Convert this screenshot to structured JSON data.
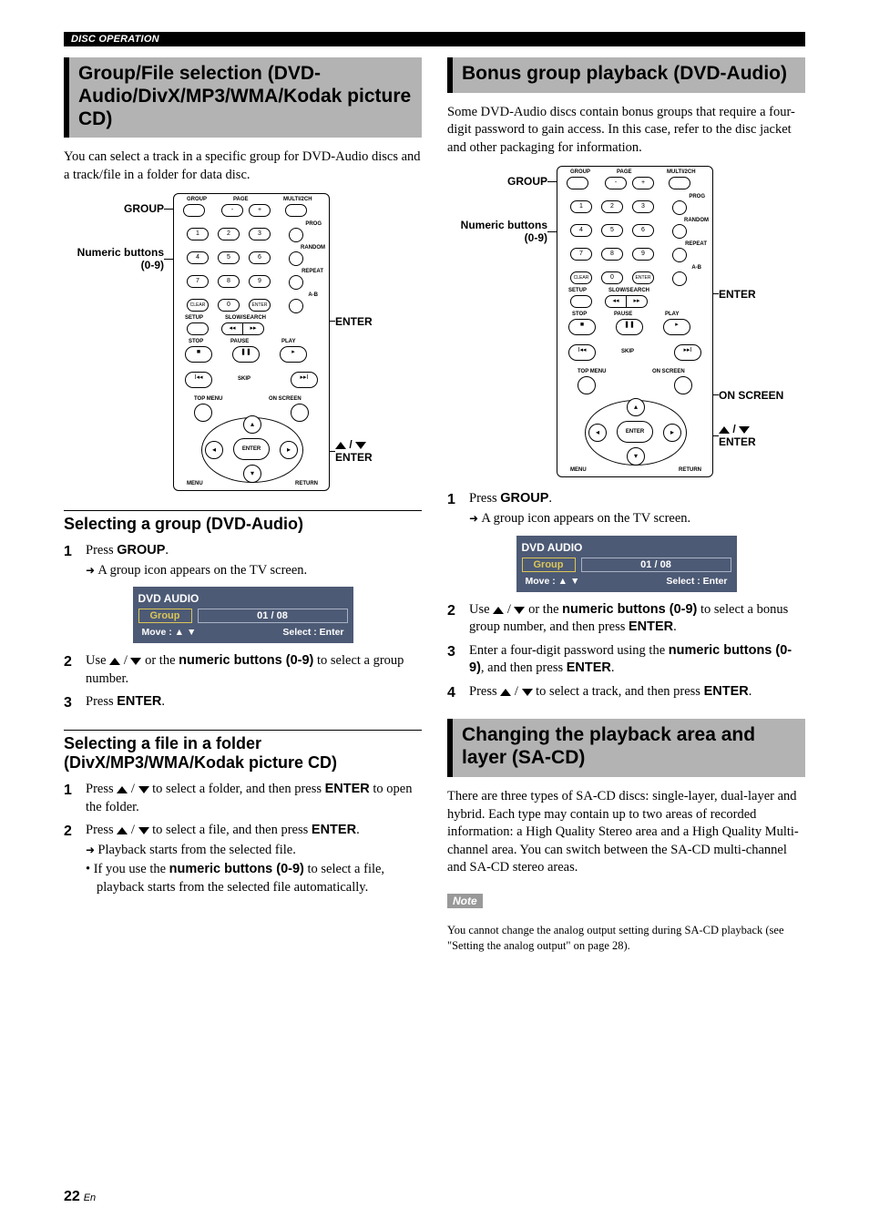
{
  "header": "DISC OPERATION",
  "left": {
    "section_title": "Group/File selection (DVD-Audio/DivX/MP3/WMA/Kodak picture CD)",
    "intro": "You can select a track in a specific group for DVD-Audio discs and a track/file in a folder for data disc.",
    "remote": {
      "group_label": "GROUP",
      "numeric_label": "Numeric buttons (0-9)",
      "enter_label": "ENTER",
      "arrows_enter": "▲ / ▼\nENTER",
      "top_row": {
        "group": "GROUP",
        "page": "PAGE",
        "multi": "MULTI/2CH"
      },
      "side": {
        "prog": "PROG",
        "random": "RANDOM",
        "repeat": "REPEAT",
        "ab": "A-B"
      },
      "row_clear": "CLEAR",
      "row_enter": "ENTER",
      "row_setup": "SETUP",
      "row_slow": "SLOW/SEARCH",
      "row_stop": "STOP",
      "row_pause": "PAUSE",
      "row_play": "PLAY",
      "row_skip": "SKIP",
      "row_topmenu": "TOP MENU",
      "row_onscreen": "ON SCREEN",
      "row_menu": "MENU",
      "row_return": "RETURN",
      "center": "ENTER"
    },
    "sub1": {
      "title": "Selecting a group (DVD-Audio)",
      "steps": [
        {
          "n": "1",
          "pre": "Press ",
          "bold": "GROUP",
          "post": ".",
          "result": "A group icon appears on the TV screen."
        },
        {
          "n": "2",
          "pre": "Use ",
          "mid": " / ",
          "post_pre": " or the ",
          "bold": "numeric buttons (0-9)",
          "post": " to select a group number."
        },
        {
          "n": "3",
          "pre": "Press ",
          "bold": "ENTER",
          "post": "."
        }
      ],
      "osd": {
        "title": "DVD AUDIO",
        "label": "Group",
        "value": "01 / 08",
        "hint_move": "Move :  ▲ ▼",
        "hint_select": "Select :  Enter"
      }
    },
    "sub2": {
      "title": "Selecting a file in a folder (DivX/MP3/WMA/Kodak picture CD)",
      "steps": [
        {
          "n": "1",
          "pre": "Press ",
          "mid": " / ",
          "post_pre": " to select a folder, and then press ",
          "bold": "ENTER",
          "post": " to open the folder."
        },
        {
          "n": "2",
          "pre": "Press ",
          "mid": " / ",
          "post_pre": " to select a file, and then press ",
          "bold": "ENTER",
          "post": ".",
          "result": "Playback starts from the selected file.",
          "bullet_pre": "If you use the ",
          "bullet_bold": "numeric buttons (0-9)",
          "bullet_post": " to select a file, playback starts from the selected file automatically."
        }
      ]
    }
  },
  "right": {
    "section1": {
      "title": "Bonus group playback (DVD-Audio)",
      "intro": "Some DVD-Audio discs contain bonus groups that require a four-digit password to gain access. In this case, refer to the disc jacket and other packaging for information.",
      "remote": {
        "group_label": "GROUP",
        "numeric_label": "Numeric buttons (0-9)",
        "enter_label": "ENTER",
        "onscreen_label": "ON SCREEN",
        "arrows_enter": "▲ / ▼\nENTER"
      },
      "steps": [
        {
          "n": "1",
          "pre": "Press ",
          "bold": "GROUP",
          "post": ".",
          "result": "A group icon appears on the TV screen."
        },
        {
          "n": "2",
          "pre": "Use ",
          "mid": " / ",
          "post_pre": " or the ",
          "bold": "numeric buttons (0-9)",
          "post": " to select a bonus group number, and then press ",
          "bold2": "ENTER",
          "post2": "."
        },
        {
          "n": "3",
          "pre": "Enter a four-digit password using the ",
          "bold": "numeric buttons (0-9)",
          "post": ", and then press ",
          "bold2": "ENTER",
          "post2": "."
        },
        {
          "n": "4",
          "pre": "Press ",
          "mid": " / ",
          "post_pre": " to select a track, and then press ",
          "bold": "ENTER",
          "post": "."
        }
      ],
      "osd": {
        "title": "DVD AUDIO",
        "label": "Group",
        "value": "01 / 08",
        "hint_move": "Move :  ▲ ▼",
        "hint_select": "Select :  Enter"
      }
    },
    "section2": {
      "title": "Changing the playback area and layer (SA-CD)",
      "intro": "There are three types of SA-CD discs: single-layer, dual-layer and hybrid. Each type may contain up to two areas of recorded information: a High Quality Stereo area and a High Quality Multi-channel area. You can switch between the SA-CD multi-channel and SA-CD stereo areas.",
      "note_label": "Note",
      "note_text": "You cannot change the analog output setting during SA-CD playback (see \"Setting the analog output\" on page 28)."
    }
  },
  "page_number": "22",
  "page_lang": "En"
}
